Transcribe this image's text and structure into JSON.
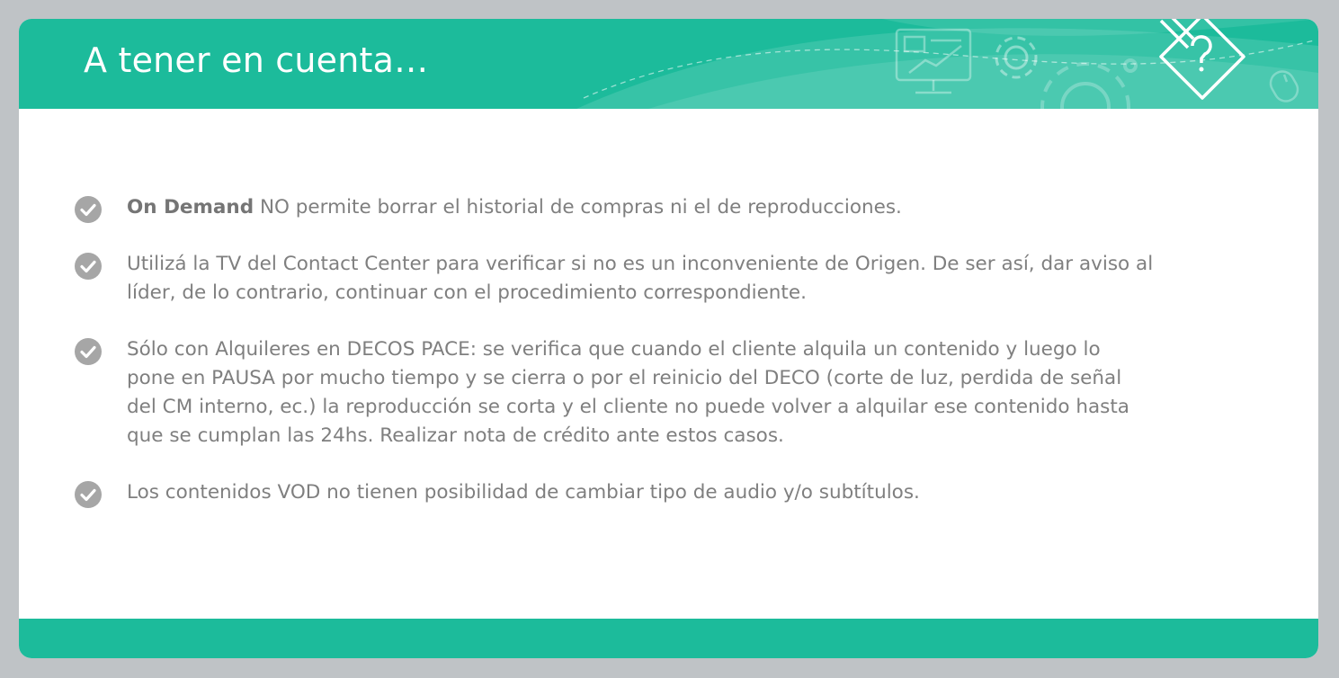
{
  "header": {
    "title": "A tener en cuenta…",
    "deco_icons": [
      "presentation-icon",
      "gear-icon",
      "large-gear-icon",
      "pencil-question-icon",
      "mouse-icon"
    ]
  },
  "items": [
    {
      "bold": "On Demand",
      "text": " NO permite borrar el historial de compras ni el de reproducciones."
    },
    {
      "bold": "",
      "text": "Utilizá la TV del Contact Center para verificar si no es un inconveniente de Origen. De ser así, dar aviso al líder, de lo contrario, continuar con el procedimiento correspondiente."
    },
    {
      "bold": "",
      "text": "Sólo con Alquileres en DECOS PACE: se verifica que cuando el cliente alquila un contenido y luego lo pone en PAUSA por mucho tiempo y se cierra o por el reinicio del DECO (corte de luz, perdida de señal del CM interno, ec.) la reproducción se corta y el cliente no puede volver a alquilar ese contenido hasta que se cumplan las 24hs. Realizar nota de crédito ante estos casos."
    },
    {
      "bold": "",
      "text": "Los contenidos VOD no tienen posibilidad de cambiar tipo de audio y/o subtítulos."
    }
  ],
  "colors": {
    "background": "#bfc3c6",
    "accent": "#1cbb9b",
    "text": "#7f7f7f",
    "check": "#a6a6a6"
  }
}
